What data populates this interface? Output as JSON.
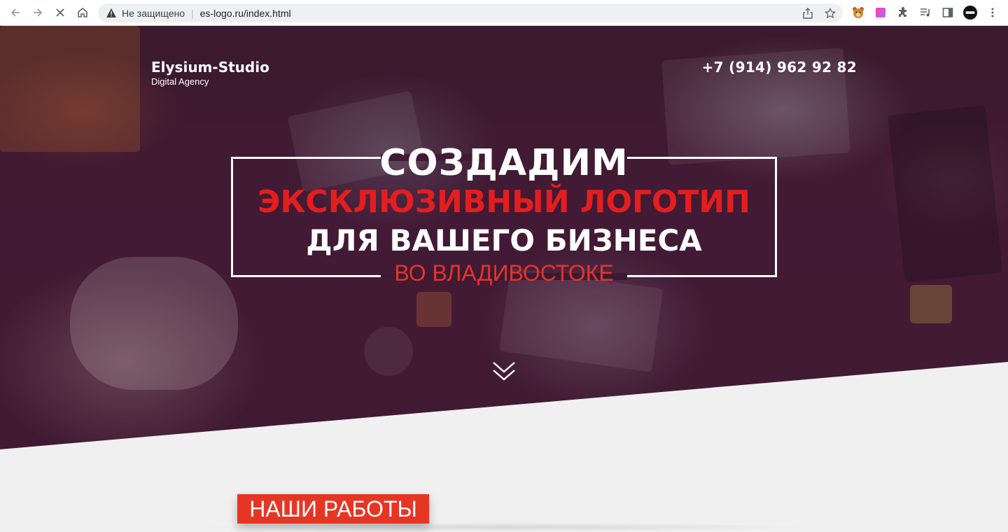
{
  "browser": {
    "security_label": "Не защищено",
    "url": "es-logo.ru/index.html",
    "icons": {
      "back": "back-arrow-icon",
      "forward": "forward-arrow-icon",
      "stop": "stop-loading-icon",
      "home": "home-icon",
      "warning": "warning-triangle-icon",
      "share": "share-icon",
      "bookmark": "star-icon",
      "extensions": "puzzle-icon",
      "media": "media-playlist-icon",
      "sidepanel": "side-panel-icon",
      "menu": "kebab-menu-icon"
    }
  },
  "site": {
    "logo_name": "Elysium-Studio",
    "logo_tagline": "Digital Agency",
    "phone": "+7 (914) 962 92 82",
    "headline": {
      "line1": "СОЗДАДИМ",
      "line2": "ЭКСКЛЮЗИВНЫЙ ЛОГОТИП",
      "line3": "ДЛЯ ВАШЕГО БИЗНЕСА",
      "line4": "ВО ВЛАДИВОСТОКЕ"
    },
    "section_title": "НАШИ РАБОТЫ",
    "colors": {
      "accent_red": "#e41e1e",
      "badge_red": "#e73524",
      "hero_overlay": "#421a34"
    }
  }
}
